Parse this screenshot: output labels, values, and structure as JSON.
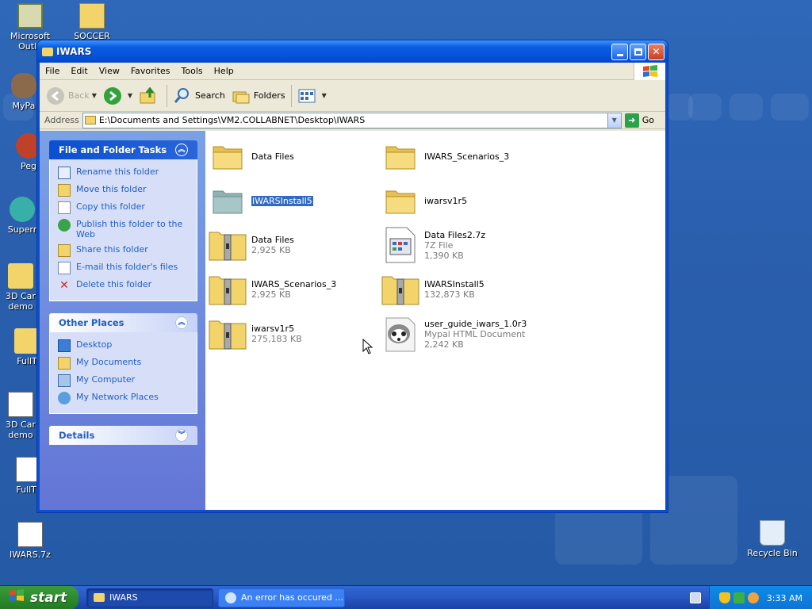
{
  "desktop": {
    "icons": [
      {
        "label": "Microsoft Outlo"
      },
      {
        "label": "SOCCER"
      },
      {
        "label": "MyPa"
      },
      {
        "label": "Peg"
      },
      {
        "label": "Superr"
      },
      {
        "label": "3D Car demo"
      },
      {
        "label": "FullT"
      },
      {
        "label": "3D Car demo"
      },
      {
        "label": "FullTil"
      },
      {
        "label": "IWARS.7z"
      },
      {
        "label": "Recycle Bin"
      }
    ]
  },
  "window": {
    "title": "IWARS",
    "menu": [
      "File",
      "Edit",
      "View",
      "Favorites",
      "Tools",
      "Help"
    ],
    "toolbar": {
      "back": "Back",
      "search": "Search",
      "folders": "Folders"
    },
    "address": {
      "label": "Address",
      "path": "E:\\Documents and Settings\\VM2.COLLABNET\\Desktop\\IWARS",
      "go": "Go"
    },
    "tasks_panel": {
      "title": "File and Folder Tasks",
      "items": [
        "Rename this folder",
        "Move this folder",
        "Copy this folder",
        "Publish this folder to the Web",
        "Share this folder",
        "E-mail this folder's files",
        "Delete this folder"
      ]
    },
    "places_panel": {
      "title": "Other Places",
      "items": [
        "Desktop",
        "My Documents",
        "My Computer",
        "My Network Places"
      ]
    },
    "details_panel": {
      "title": "Details"
    },
    "files": [
      {
        "name": "Data Files",
        "line2": "",
        "line3": "",
        "kind": "folder"
      },
      {
        "name": "IWARS_Scenarios_3",
        "line2": "",
        "line3": "",
        "kind": "folder"
      },
      {
        "name": "IWARSInstall5",
        "line2": "",
        "line3": "",
        "kind": "folder-selected"
      },
      {
        "name": "iwarsv1r5",
        "line2": "",
        "line3": "",
        "kind": "folder"
      },
      {
        "name": "Data Files",
        "line2": "2,925 KB",
        "line3": "",
        "kind": "zip"
      },
      {
        "name": "Data Files2.7z",
        "line2": "7Z File",
        "line3": "1,390 KB",
        "kind": "7z"
      },
      {
        "name": "IWARS_Scenarios_3",
        "line2": "2,925 KB",
        "line3": "",
        "kind": "zip"
      },
      {
        "name": "IWARSInstall5",
        "line2": "132,873 KB",
        "line3": "",
        "kind": "zip"
      },
      {
        "name": "iwarsv1r5",
        "line2": "275,183 KB",
        "line3": "",
        "kind": "zip"
      },
      {
        "name": "user_guide_iwars_1.0r3",
        "line2": "Mypal HTML Document",
        "line3": "2,242 KB",
        "kind": "html"
      }
    ]
  },
  "taskbar": {
    "start": "start",
    "tasks": [
      "IWARS",
      "An error has occured ..."
    ],
    "clock": "3:33 AM"
  }
}
